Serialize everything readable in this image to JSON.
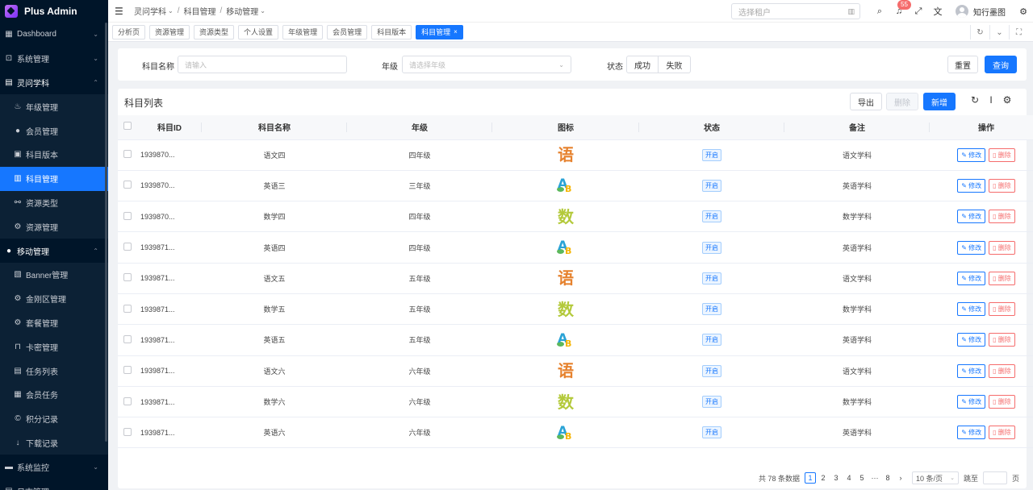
{
  "app": {
    "title": "Plus Admin"
  },
  "sidebar": {
    "items": [
      {
        "label": "Dashboard",
        "icon": "grid-icon",
        "glyph": "▦",
        "level": 1,
        "arrow": "⌄"
      },
      {
        "label": "系统管理",
        "icon": "desktop-icon",
        "glyph": "⊡",
        "level": 1,
        "arrow": "⌄"
      },
      {
        "label": "灵问学科",
        "icon": "book-icon",
        "glyph": "▤",
        "level": 1,
        "arrow": "⌃",
        "open": true
      },
      {
        "label": "年级管理",
        "icon": "flame-icon",
        "glyph": "♨",
        "level": 2
      },
      {
        "label": "会员管理",
        "icon": "chat-icon",
        "glyph": "●",
        "level": 2
      },
      {
        "label": "科目版本",
        "icon": "file-icon",
        "glyph": "▣",
        "level": 2
      },
      {
        "label": "科目管理",
        "icon": "list-icon",
        "glyph": "▥",
        "level": 2,
        "active": true
      },
      {
        "label": "资源类型",
        "icon": "link-icon",
        "glyph": "⚯",
        "level": 2
      },
      {
        "label": "资源管理",
        "icon": "gear-icon",
        "glyph": "⚙",
        "level": 2
      },
      {
        "label": "移动管理",
        "icon": "chat-icon",
        "glyph": "●",
        "level": 1,
        "arrow": "⌃",
        "open": true
      },
      {
        "label": "Banner管理",
        "icon": "image-icon",
        "glyph": "▧",
        "level": 2
      },
      {
        "label": "金刚区管理",
        "icon": "settings-icon",
        "glyph": "⚙",
        "level": 2
      },
      {
        "label": "套餐管理",
        "icon": "package-icon",
        "glyph": "⚙",
        "level": 2
      },
      {
        "label": "卡密管理",
        "icon": "lock-icon",
        "glyph": "⊓",
        "level": 2
      },
      {
        "label": "任务列表",
        "icon": "task-icon",
        "glyph": "▤",
        "level": 2
      },
      {
        "label": "会员任务",
        "icon": "member-task-icon",
        "glyph": "▦",
        "level": 2
      },
      {
        "label": "积分记录",
        "icon": "coin-icon",
        "glyph": "©",
        "level": 2
      },
      {
        "label": "下载记录",
        "icon": "download-icon",
        "glyph": "↓",
        "level": 2
      },
      {
        "label": "系统监控",
        "icon": "monitor-icon",
        "glyph": "▬",
        "level": 1,
        "arrow": "⌄"
      },
      {
        "label": "日志管理",
        "icon": "log-icon",
        "glyph": "▤",
        "level": 1,
        "arrow": "⌄"
      }
    ]
  },
  "header": {
    "breadcrumb": [
      "灵问学科",
      "科目管理",
      "移动管理"
    ],
    "tenant_placeholder": "选择租户",
    "notification_count": "55",
    "username": "知行墨图"
  },
  "tabs": [
    {
      "label": "分析页"
    },
    {
      "label": "资源管理"
    },
    {
      "label": "资源类型"
    },
    {
      "label": "个人设置"
    },
    {
      "label": "年级管理"
    },
    {
      "label": "会员管理"
    },
    {
      "label": "科目版本"
    },
    {
      "label": "科目管理",
      "active": true
    }
  ],
  "search": {
    "subject_name_label": "科目名称",
    "subject_name_placeholder": "请输入",
    "grade_label": "年级",
    "grade_placeholder": "请选择年级",
    "status_label": "状态",
    "status_success": "成功",
    "status_fail": "失败",
    "reset_label": "重置",
    "query_label": "查询"
  },
  "table": {
    "title": "科目列表",
    "export_label": "导出",
    "delete_label": "删除",
    "add_label": "新增",
    "columns": [
      "科目ID",
      "科目名称",
      "年级",
      "图标",
      "状态",
      "备注",
      "操作"
    ],
    "edit_label": "修改",
    "row_delete_label": "删除",
    "rows": [
      {
        "id": "1939870...",
        "name": "语文四",
        "grade": "四年级",
        "icon": "yu",
        "status": "开启",
        "note": "语文学科"
      },
      {
        "id": "1939870...",
        "name": "英语三",
        "grade": "三年级",
        "icon": "en",
        "status": "开启",
        "note": "英语学科"
      },
      {
        "id": "1939870...",
        "name": "数学四",
        "grade": "四年级",
        "icon": "shu",
        "status": "开启",
        "note": "数学学科"
      },
      {
        "id": "1939871...",
        "name": "英语四",
        "grade": "四年级",
        "icon": "en",
        "status": "开启",
        "note": "英语学科"
      },
      {
        "id": "1939871...",
        "name": "语文五",
        "grade": "五年级",
        "icon": "yu",
        "status": "开启",
        "note": "语文学科"
      },
      {
        "id": "1939871...",
        "name": "数学五",
        "grade": "五年级",
        "icon": "shu",
        "status": "开启",
        "note": "数学学科"
      },
      {
        "id": "1939871...",
        "name": "英语五",
        "grade": "五年级",
        "icon": "en",
        "status": "开启",
        "note": "英语学科"
      },
      {
        "id": "1939871...",
        "name": "语文六",
        "grade": "六年级",
        "icon": "yu",
        "status": "开启",
        "note": "语文学科"
      },
      {
        "id": "1939871...",
        "name": "数学六",
        "grade": "六年级",
        "icon": "shu",
        "status": "开启",
        "note": "数学学科"
      },
      {
        "id": "1939871...",
        "name": "英语六",
        "grade": "六年级",
        "icon": "en",
        "status": "开启",
        "note": "英语学科"
      }
    ]
  },
  "pagination": {
    "total_text": "共 78 条数据",
    "pages": [
      "1",
      "2",
      "3",
      "4",
      "5",
      "···",
      "8"
    ],
    "current": "1",
    "page_size": "10 条/页",
    "jump_label": "跳至",
    "page_unit": "页"
  },
  "icon_glyphs": {
    "yu": "语",
    "shu": "数",
    "en_a": "A",
    "en_b": "B"
  },
  "colors": {
    "primary": "#1677ff",
    "sidebar_bg": "#001529",
    "danger": "#f56c6c"
  }
}
